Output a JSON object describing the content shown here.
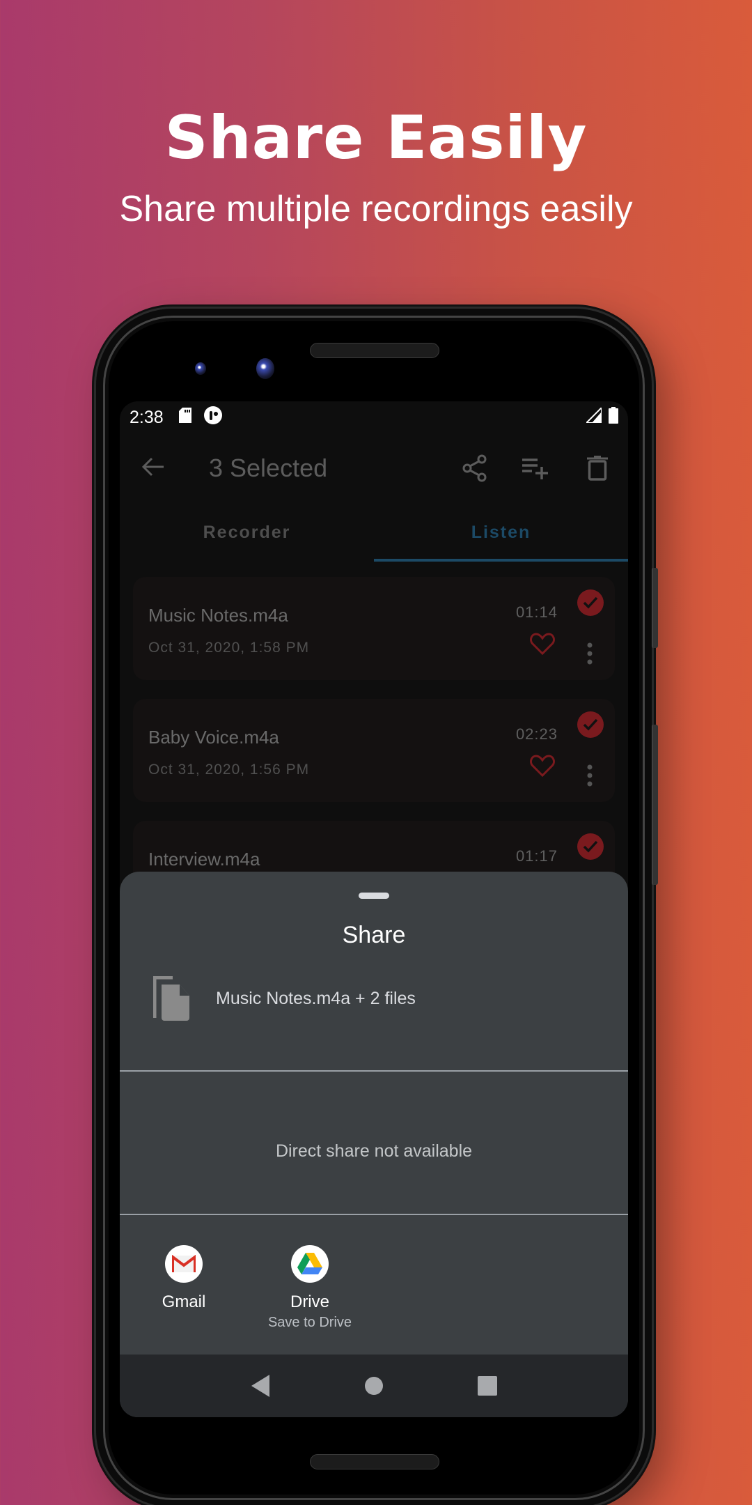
{
  "hero": {
    "title": "Share Easily",
    "subtitle": "Share multiple recordings easily"
  },
  "status_bar": {
    "time": "2:38",
    "icons": [
      "sd-card-icon",
      "app-notification-icon",
      "signal-icon",
      "battery-icon"
    ]
  },
  "app_bar": {
    "title": "3 Selected",
    "actions": [
      "share-icon",
      "add-to-playlist-icon",
      "delete-icon"
    ]
  },
  "tabs": [
    {
      "label": "Recorder",
      "active": false
    },
    {
      "label": "Listen",
      "active": true
    }
  ],
  "recordings": [
    {
      "name": "Music Notes.m4a",
      "date": "Oct 31, 2020, 1:58 PM",
      "duration": "01:14",
      "selected": true
    },
    {
      "name": "Baby Voice.m4a",
      "date": "Oct 31, 2020, 1:56 PM",
      "duration": "02:23",
      "selected": true
    },
    {
      "name": "Interview.m4a",
      "date": "",
      "duration": "01:17",
      "selected": true
    }
  ],
  "share_sheet": {
    "title": "Share",
    "file_summary": "Music Notes.m4a + 2 files",
    "direct_share_message": "Direct share not available",
    "targets": [
      {
        "label": "Gmail",
        "sublabel": ""
      },
      {
        "label": "Drive",
        "sublabel": "Save to Drive"
      }
    ]
  },
  "colors": {
    "accent_tab": "#1c4a66",
    "selected_check": "#7a1a1e",
    "sheet_bg": "#3c4043",
    "gradient_start": "#a93a6b",
    "gradient_end": "#d95b3b"
  }
}
